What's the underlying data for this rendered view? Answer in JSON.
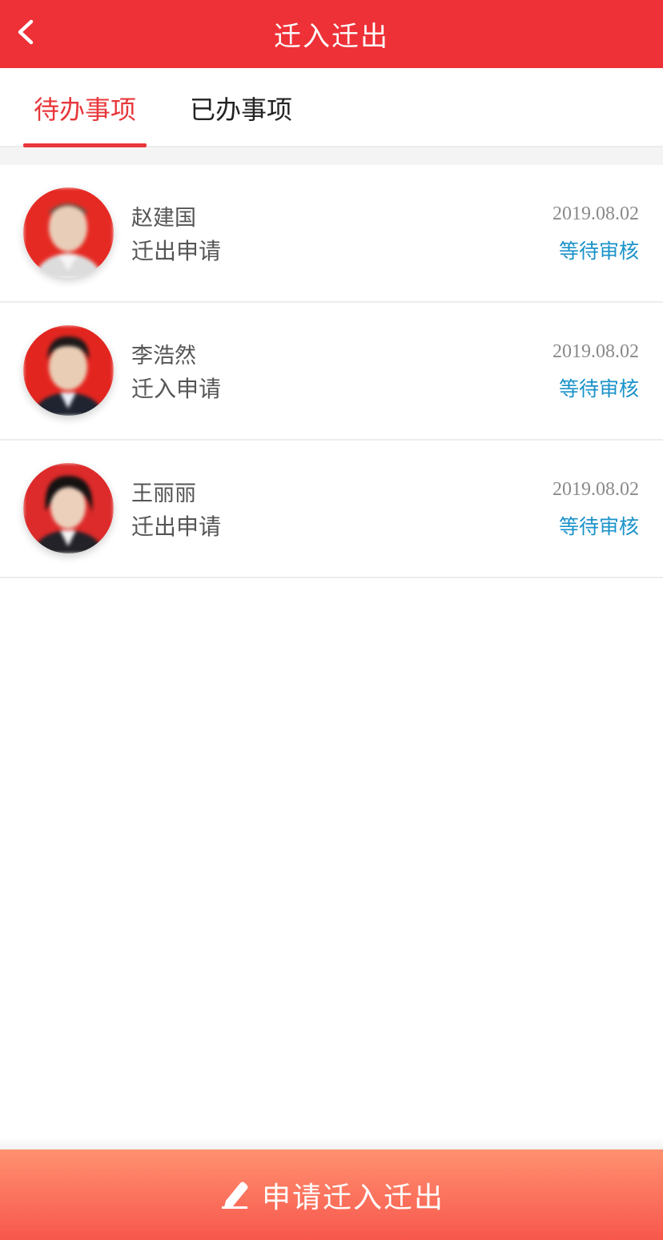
{
  "header": {
    "title": "迁入迁出",
    "back_icon": "chevron-left-icon"
  },
  "tabs": [
    {
      "label": "待办事项",
      "active": true
    },
    {
      "label": "已办事项",
      "active": false
    }
  ],
  "colors": {
    "header_bg": "#ee3137",
    "accent_red": "#e8373b",
    "status_blue": "#1b93c9",
    "button_gradient_top": "#ff9170",
    "button_gradient_bottom": "#f8574c"
  },
  "items": [
    {
      "name": "赵建国",
      "type": "迁出申请",
      "date": "2019.08.02",
      "status": "等待审核"
    },
    {
      "name": "李浩然",
      "type": "迁入申请",
      "date": "2019.08.02",
      "status": "等待审核"
    },
    {
      "name": "王丽丽",
      "type": "迁出申请",
      "date": "2019.08.02",
      "status": "等待审核"
    }
  ],
  "apply_button": {
    "label": "申请迁入迁出",
    "icon": "pencil-icon"
  }
}
